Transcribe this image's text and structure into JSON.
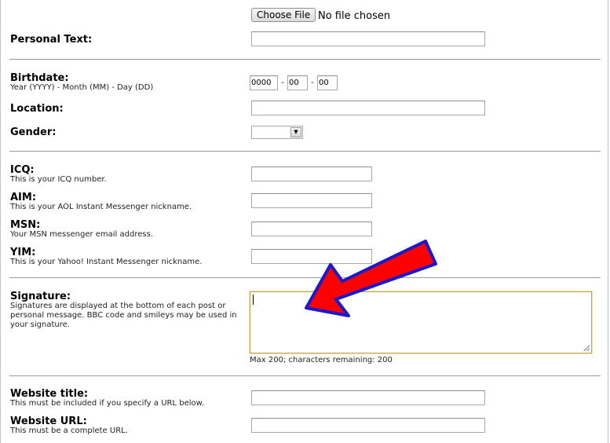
{
  "avatar_upload": {
    "button_label": "Choose File",
    "status": "No file chosen"
  },
  "personal_text": {
    "label": "Personal Text:",
    "value": ""
  },
  "birthdate": {
    "label": "Birthdate:",
    "hint": "Year (YYYY) - Month (MM) - Day (DD)",
    "year": "0000",
    "month": "00",
    "day": "00",
    "separator": "-"
  },
  "location": {
    "label": "Location:",
    "value": ""
  },
  "gender": {
    "label": "Gender:",
    "selected": ""
  },
  "icq": {
    "label": "ICQ:",
    "hint": "This is your ICQ number.",
    "value": ""
  },
  "aim": {
    "label": "AIM:",
    "hint": "This is your AOL Instant Messenger nickname.",
    "value": ""
  },
  "msn": {
    "label": "MSN:",
    "hint": "Your MSN messenger email address.",
    "value": ""
  },
  "yim": {
    "label": "YIM:",
    "hint": "This is your Yahoo! Instant Messenger nickname.",
    "value": ""
  },
  "signature": {
    "label": "Signature:",
    "hint": "Signatures are displayed at the bottom of each post or personal message. BBC code and smileys may be used in your signature.",
    "value": "",
    "limit_text": "Max 200; characters remaining: 200"
  },
  "website_title": {
    "label": "Website title:",
    "hint": "This must be included if you specify a URL below.",
    "value": ""
  },
  "website_url": {
    "label": "Website URL:",
    "hint": "This must be a complete URL.",
    "value": ""
  },
  "annotation": {
    "arrow_fill": "#ff0000",
    "arrow_stroke": "#1a1acc"
  }
}
